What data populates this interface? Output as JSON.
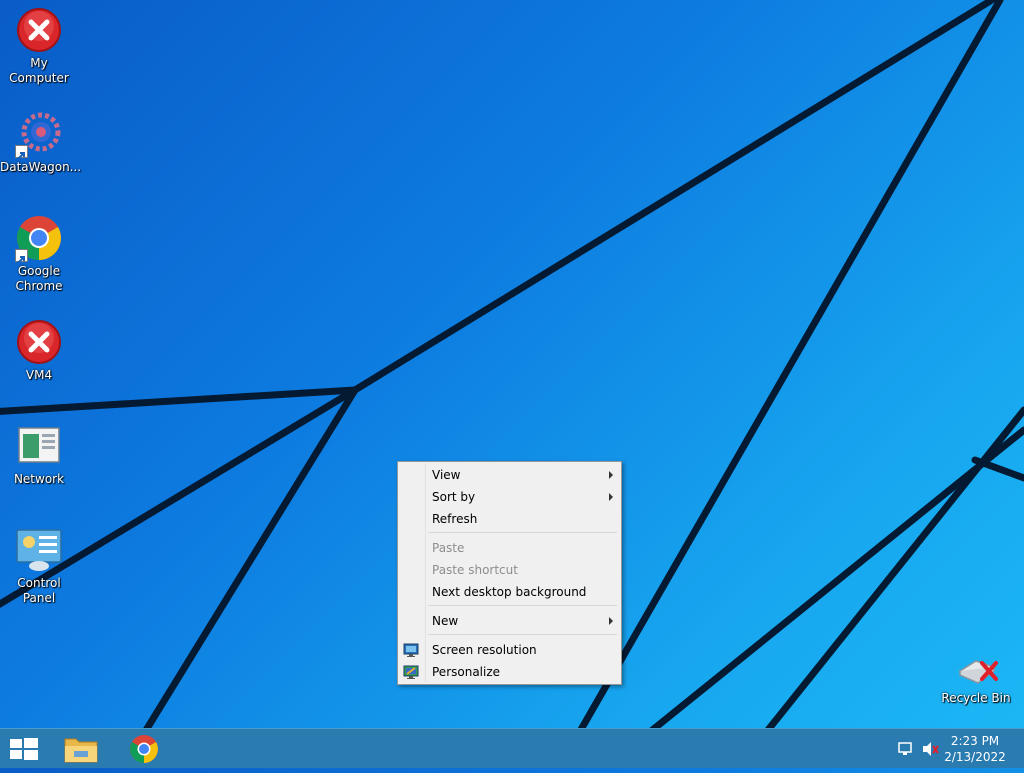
{
  "desktop": {
    "icons": [
      {
        "label": "My Computer",
        "icon": "error-icon"
      },
      {
        "label": "DataWagon...",
        "icon": "gear-shortcut-icon"
      },
      {
        "label": "Google Chrome",
        "icon": "chrome-icon"
      },
      {
        "label": "VM4",
        "icon": "error-icon"
      },
      {
        "label": "Network",
        "icon": "network-icon"
      },
      {
        "label": "Control Panel",
        "icon": "control-panel-icon"
      }
    ],
    "recycle_bin": {
      "label": "Recycle Bin",
      "icon": "recycle-bin-icon"
    }
  },
  "context_menu": {
    "items": [
      {
        "label": "View",
        "submenu": true,
        "enabled": true
      },
      {
        "label": "Sort by",
        "submenu": true,
        "enabled": true
      },
      {
        "label": "Refresh",
        "enabled": true
      },
      {
        "label": "Paste",
        "enabled": false
      },
      {
        "label": "Paste shortcut",
        "enabled": false
      },
      {
        "label": "Next desktop background",
        "enabled": true
      },
      {
        "label": "New",
        "submenu": true,
        "enabled": true
      },
      {
        "label": "Screen resolution",
        "enabled": true,
        "icon": "monitor-icon"
      },
      {
        "label": "Personalize",
        "enabled": true,
        "icon": "personalize-icon"
      }
    ]
  },
  "taskbar": {
    "pinned": [
      "start-button",
      "file-explorer",
      "google-chrome"
    ],
    "clock": {
      "time": "2:23 PM",
      "date": "2/13/2022"
    },
    "tray_icons": [
      "network-icon",
      "volume-muted-icon"
    ]
  },
  "colors": {
    "wallpaper_dark": "#0a5cc7",
    "wallpaper_light": "#1cb8f5",
    "menu_bg": "#f0f0f0",
    "taskbar": "#2a7bb0"
  }
}
